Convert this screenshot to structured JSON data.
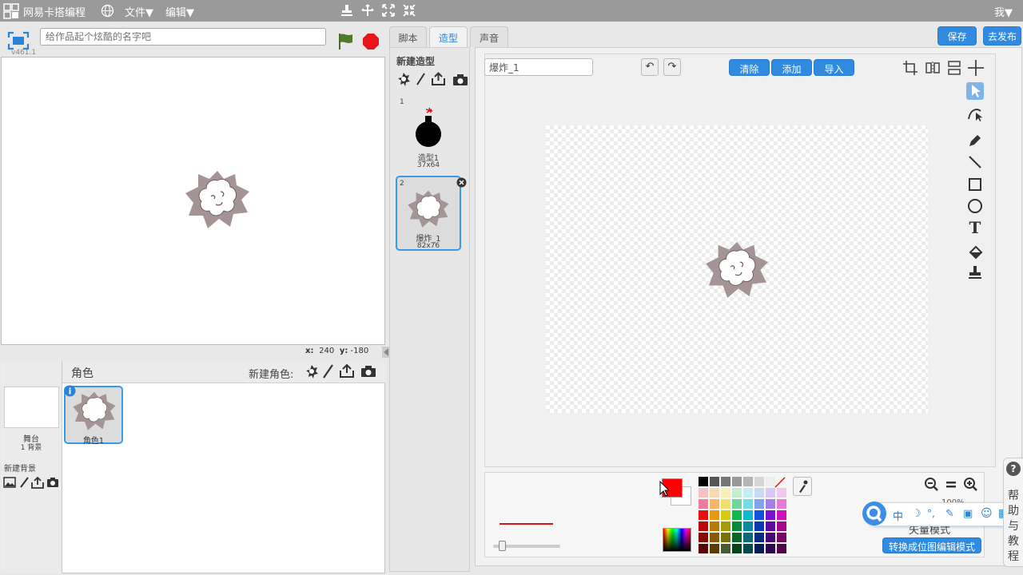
{
  "menubar": {
    "app_name": "网易卡搭编程",
    "file_menu": "文件▼",
    "edit_menu": "编辑▼",
    "user": "我▼"
  },
  "stage": {
    "title_placeholder": "给作品起个炫酷的名字吧",
    "version": "v461.1",
    "x_label": "x:",
    "x_value": "240",
    "y_label": "y:",
    "y_value": "-180"
  },
  "tabs": [
    {
      "label": "脚本"
    },
    {
      "label": "造型"
    },
    {
      "label": "声音"
    }
  ],
  "top_buttons": {
    "save": "保存",
    "publish": "去发布"
  },
  "costumes": {
    "header": "新建造型",
    "items": [
      {
        "index": "1",
        "name": "造型1",
        "size": "37x64"
      },
      {
        "index": "2",
        "name": "爆炸_1",
        "size": "82x76"
      }
    ]
  },
  "editor": {
    "costume_name": "爆炸_1",
    "clear": "清除",
    "add": "添加",
    "import": "导入",
    "zoom_level": "100%",
    "vector_mode": "矢量模式",
    "convert_bitmap": "转换成位图编辑模式",
    "fill_color": "#ff0000"
  },
  "sprites": {
    "header": "角色",
    "new_sprite": "新建角色:",
    "stage_label": "舞台",
    "stage_backdrops": "1 背景",
    "new_backdrop": "新建背景",
    "items": [
      {
        "name": "角色1"
      }
    ]
  },
  "help": {
    "icon": "?",
    "label": "帮助与教程"
  },
  "ime": {
    "mode": "中",
    "items": [
      "☽",
      "°,",
      "✎",
      "▣",
      "☺",
      "▦"
    ]
  }
}
